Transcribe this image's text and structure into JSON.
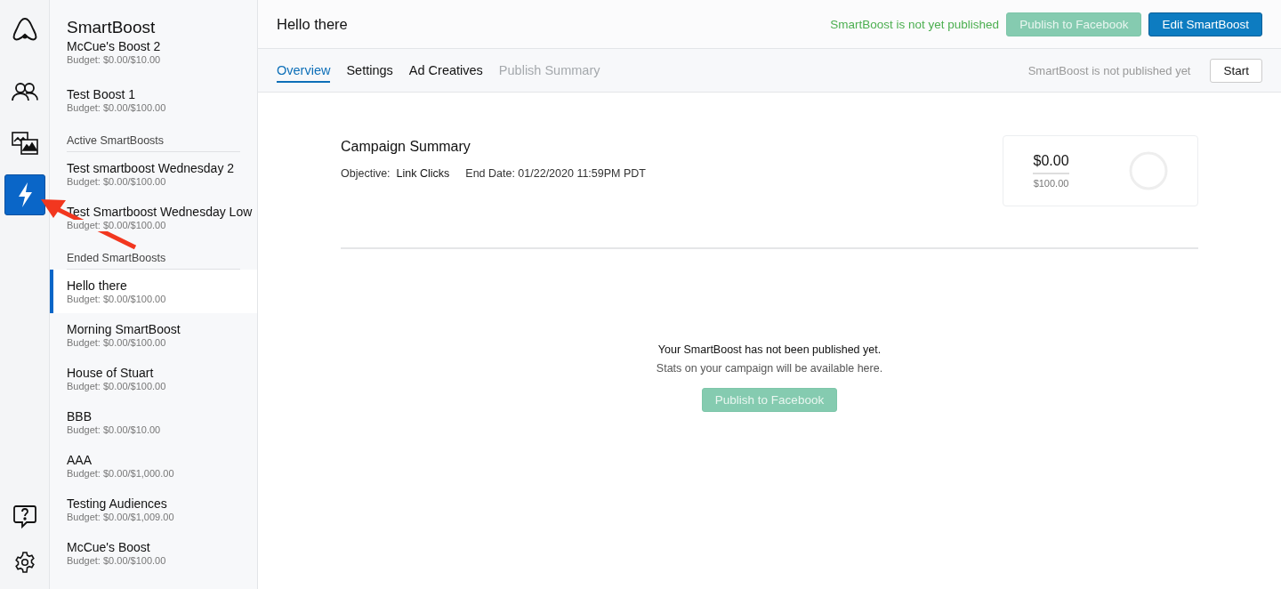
{
  "nav_items": [
    {
      "kind": "people",
      "selected": false
    },
    {
      "kind": "images",
      "selected": false
    },
    {
      "kind": "bolt",
      "selected": true
    }
  ],
  "sidebar": {
    "title": "SmartBoost",
    "groups": [
      {
        "items": [
          {
            "name": "McCue's Boost 2",
            "budget": "Budget: $0.00/$10.00",
            "selected": false
          },
          {
            "name": "Test Boost 1",
            "budget": "Budget: $0.00/$100.00",
            "selected": false
          }
        ]
      },
      {
        "heading": "Active SmartBoosts",
        "items": [
          {
            "name": "Test smartboost Wednesday 2",
            "budget": "Budget: $0.00/$100.00",
            "selected": false
          },
          {
            "name": "Test Smartboost Wednesday Low",
            "budget": "Budget: $0.00/$100.00",
            "selected": false
          }
        ]
      },
      {
        "heading": "Ended SmartBoosts",
        "items": [
          {
            "name": "Hello there",
            "budget": "Budget: $0.00/$100.00",
            "selected": true
          },
          {
            "name": "Morning SmartBoost",
            "budget": "Budget: $0.00/$100.00",
            "selected": false
          },
          {
            "name": "House of Stuart",
            "budget": "Budget: $0.00/$100.00",
            "selected": false
          },
          {
            "name": "BBB",
            "budget": "Budget: $0.00/$10.00",
            "selected": false
          },
          {
            "name": "AAA",
            "budget": "Budget: $0.00/$1,000.00",
            "selected": false
          },
          {
            "name": "Testing Audiences",
            "budget": "Budget: $0.00/$1,009.00",
            "selected": false
          },
          {
            "name": "McCue's Boost",
            "budget": "Budget: $0.00/$100.00",
            "selected": false
          }
        ]
      }
    ]
  },
  "header": {
    "title": "Hello there",
    "status": "SmartBoost is not yet published",
    "publish_button": {
      "label": "Publish to Facebook",
      "disabled": true
    },
    "edit_button": "Edit SmartBoost"
  },
  "tabs": [
    {
      "label": "Overview",
      "selected": true,
      "disabled": false
    },
    {
      "label": "Settings",
      "selected": false,
      "disabled": false
    },
    {
      "label": "Ad Creatives",
      "selected": false,
      "disabled": false
    },
    {
      "label": "Publish Summary",
      "selected": false,
      "disabled": true
    }
  ],
  "tab_bar_status": "SmartBoost is not published yet",
  "start_button": "Start",
  "summary": {
    "title": "Campaign Summary",
    "objective_label": "Objective:",
    "objective": "Link Clicks",
    "end_date": "End Date: 01/22/2020 11:59PM PDT",
    "spent": "$0.00",
    "budget": "$100.00",
    "level": 0
  },
  "empty_state": {
    "title": "Your SmartBoost has not been published yet.",
    "subtitle": "Stats on your campaign will be available here.",
    "button": {
      "label": "Publish to Facebook",
      "disabled": true
    }
  }
}
